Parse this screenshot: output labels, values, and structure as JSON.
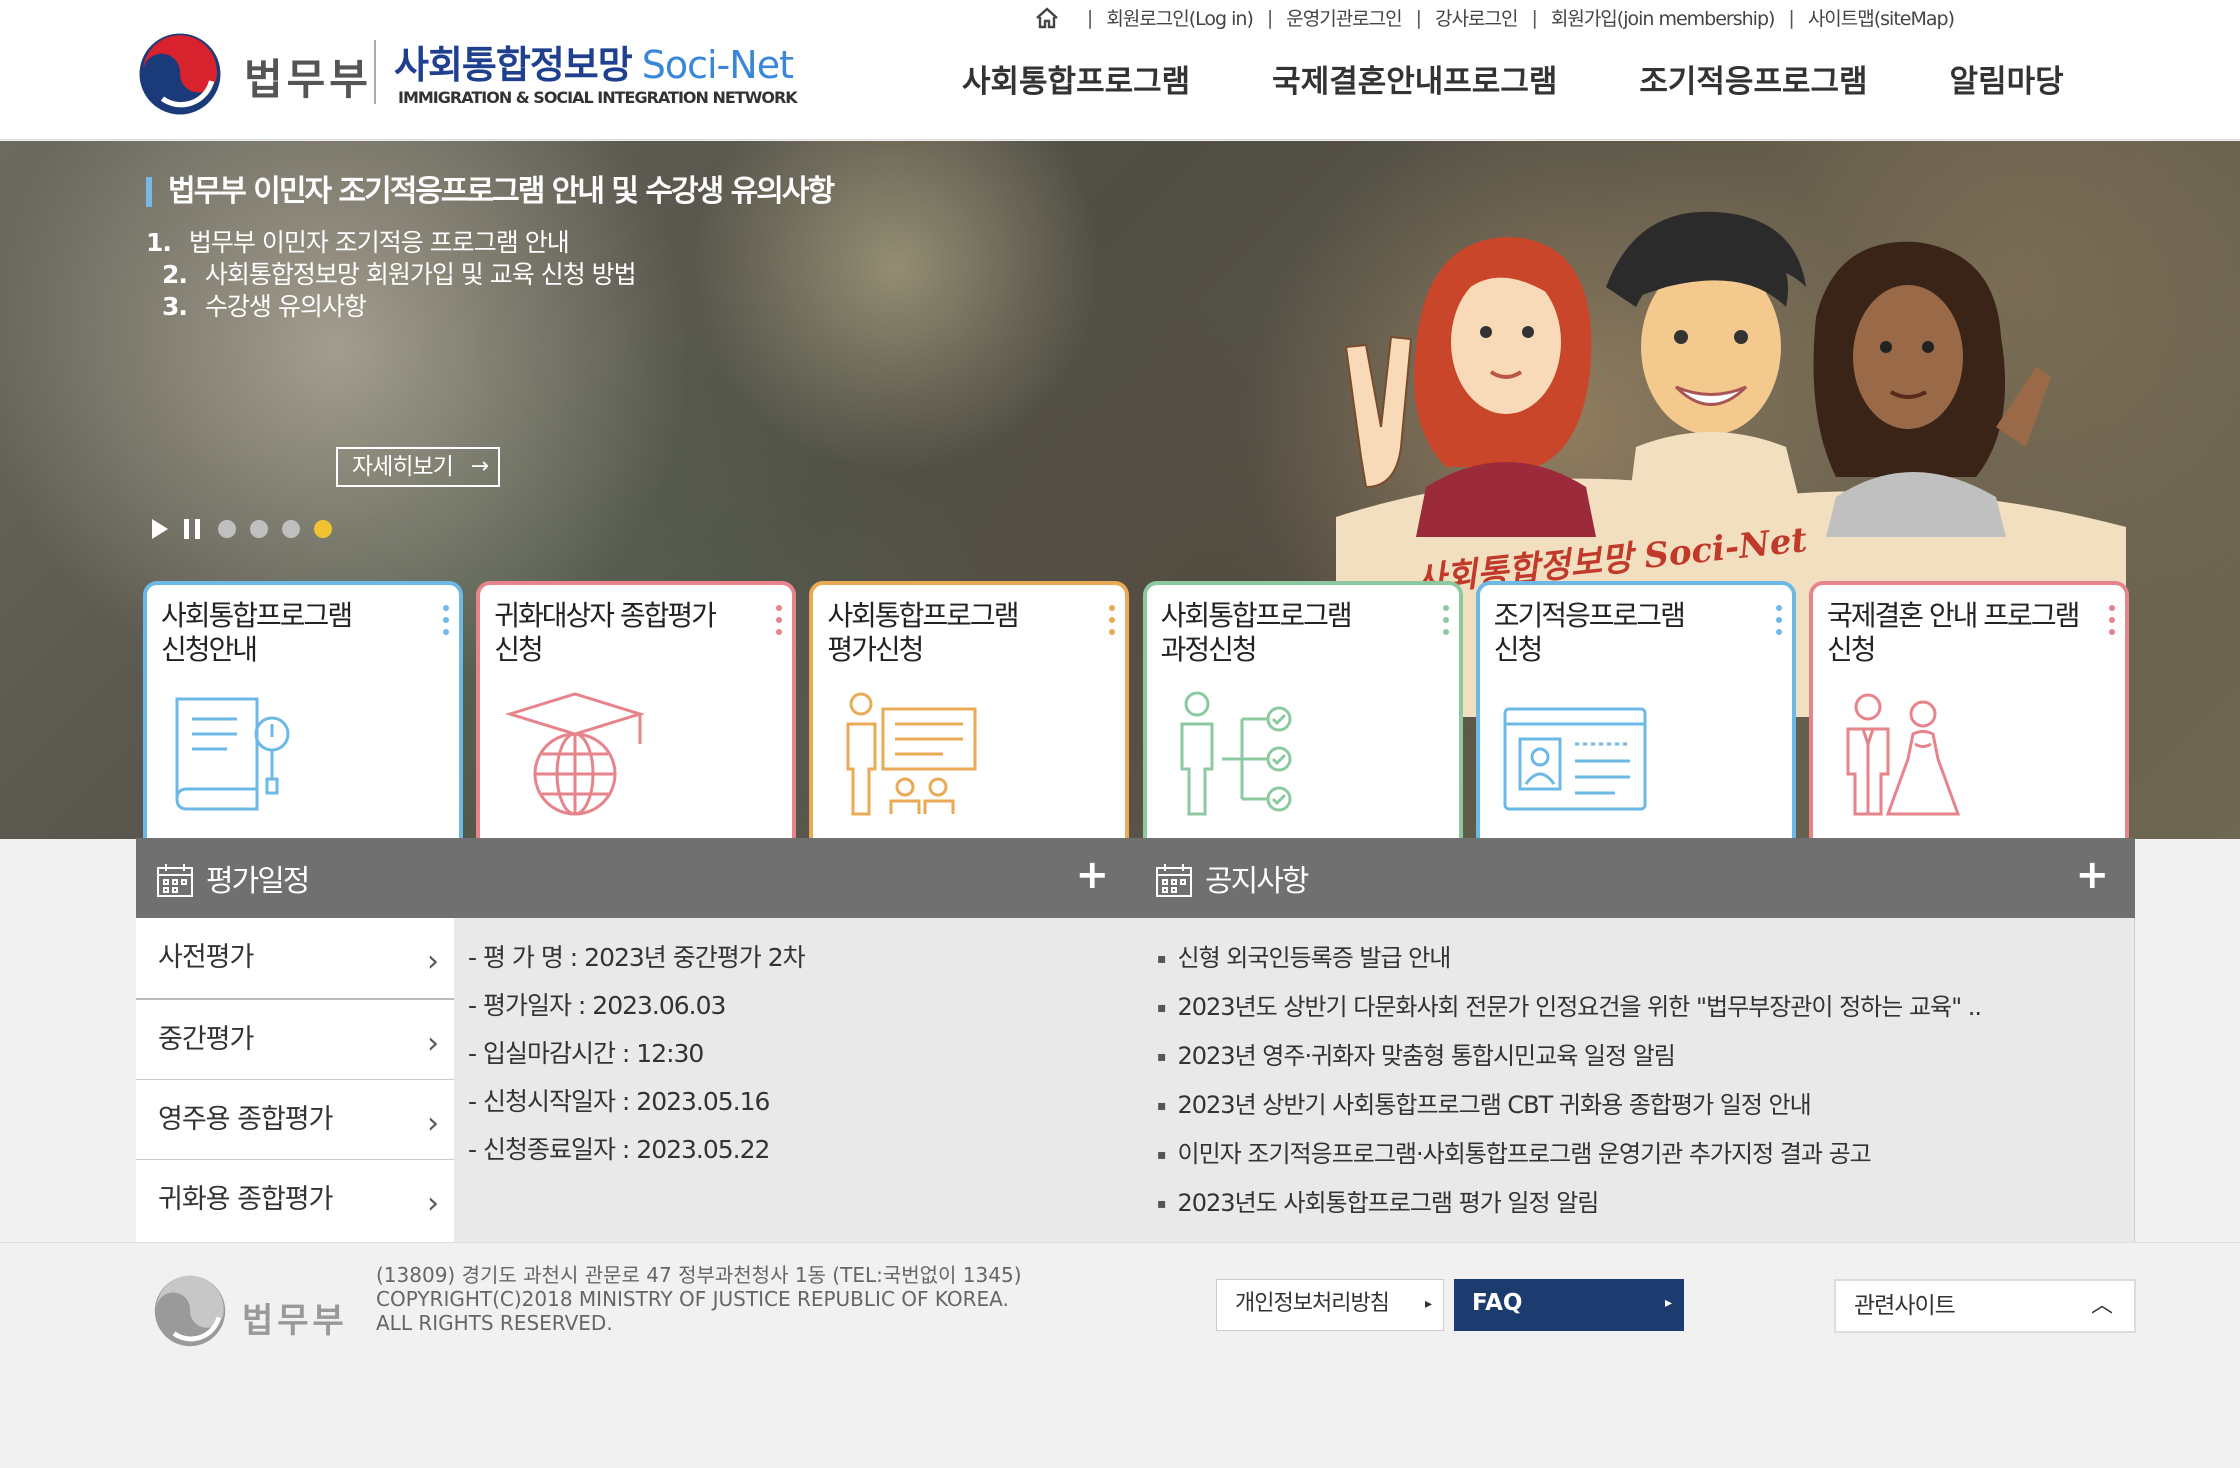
{
  "header": {
    "logo_moj": "법무부",
    "logo_name": "사회통합정보망",
    "logo_name_en": "Soci-Net",
    "logo_sub": "IMMIGRATION & SOCIAL INTEGRATION NETWORK",
    "utility": [
      "회원로그인(Log in)",
      "운영기관로그인",
      "강사로그인",
      "회원가입(join membership)",
      "사이트맵(siteMap)"
    ],
    "gnb": [
      "사회통합프로그램",
      "국제결혼안내프로그램",
      "조기적응프로그램",
      "알림마당"
    ]
  },
  "hero": {
    "title": "법무부 이민자 조기적응프로그램 안내 및 수강생 유의사항",
    "items": [
      {
        "num": "1.",
        "text": "법무부 이민자 조기적응 프로그램 안내"
      },
      {
        "num": "2.",
        "text": "사회통합정보망 회원가입 및 교육 신청 방법"
      },
      {
        "num": "3.",
        "text": "수강생 유의사항"
      }
    ],
    "more": "자세히보기",
    "slides_total": 4,
    "slide_active": 4,
    "banner_text": "사회통합정보망 Soci-Net"
  },
  "cards": [
    {
      "label": "사회통합프로그램\n신청안내",
      "color": "#6cb8e6",
      "icon": "book-info-icon"
    },
    {
      "label": "귀화대상자 종합평가\n신청",
      "color": "#e7838a",
      "icon": "globe-graduation-icon"
    },
    {
      "label": "사회통합프로그램\n평가신청",
      "color": "#eaaa55",
      "icon": "presentation-icon"
    },
    {
      "label": "사회통합프로그램\n과정신청",
      "color": "#8dc9a0",
      "icon": "process-tree-icon"
    },
    {
      "label": "조기적응프로그램\n신청",
      "color": "#6cb8e6",
      "icon": "id-card-icon"
    },
    {
      "label": "국제결혼 안내 프로그램\n신청",
      "color": "#e7838a",
      "icon": "couple-icon"
    }
  ],
  "schedule": {
    "title": "평가일정",
    "tabs": [
      "사전평가",
      "중간평가",
      "영주용 종합평가",
      "귀화용 종합평가"
    ],
    "active_tab": 0,
    "details": [
      "- 평 가 명 : 2023년 중간평가 2차",
      "- 평가일자 : 2023.06.03",
      "- 입실마감시간 : 12:30",
      "- 신청시작일자 : 2023.05.16",
      "- 신청종료일자 : 2023.05.22"
    ]
  },
  "notice": {
    "title": "공지사항",
    "items": [
      "신형 외국인등록증 발급 안내",
      "2023년도 상반기 다문화사회 전문가 인정요건을 위한 \"법무부장관이 정하는 교육\" ..",
      "2023년 영주·귀화자 맞춤형 통합시민교육 일정 알림",
      "2023년 상반기 사회통합프로그램 CBT 귀화용 종합평가 일정 안내",
      "이민자 조기적응프로그램·사회통합프로그램 운영기관 추가지정 결과 공고",
      "2023년도 사회통합프로그램 평가 일정 알림"
    ]
  },
  "footer": {
    "logo_moj": "법무부",
    "address": "(13809) 경기도 과천시 관문로 47 정부과천청사 1동 (TEL:국번없이 1345)",
    "copyright1": "COPYRIGHT(C)2018 MINISTRY OF JUSTICE REPUBLIC OF KOREA.",
    "copyright2": "ALL RIGHTS RESERVED.",
    "privacy": "개인정보처리방침",
    "faq": "FAQ",
    "related": "관련사이트"
  },
  "colors": {
    "accent_blue": "#1c3b6e",
    "active_dot": "#f1c232",
    "panel_head": "#707070"
  }
}
